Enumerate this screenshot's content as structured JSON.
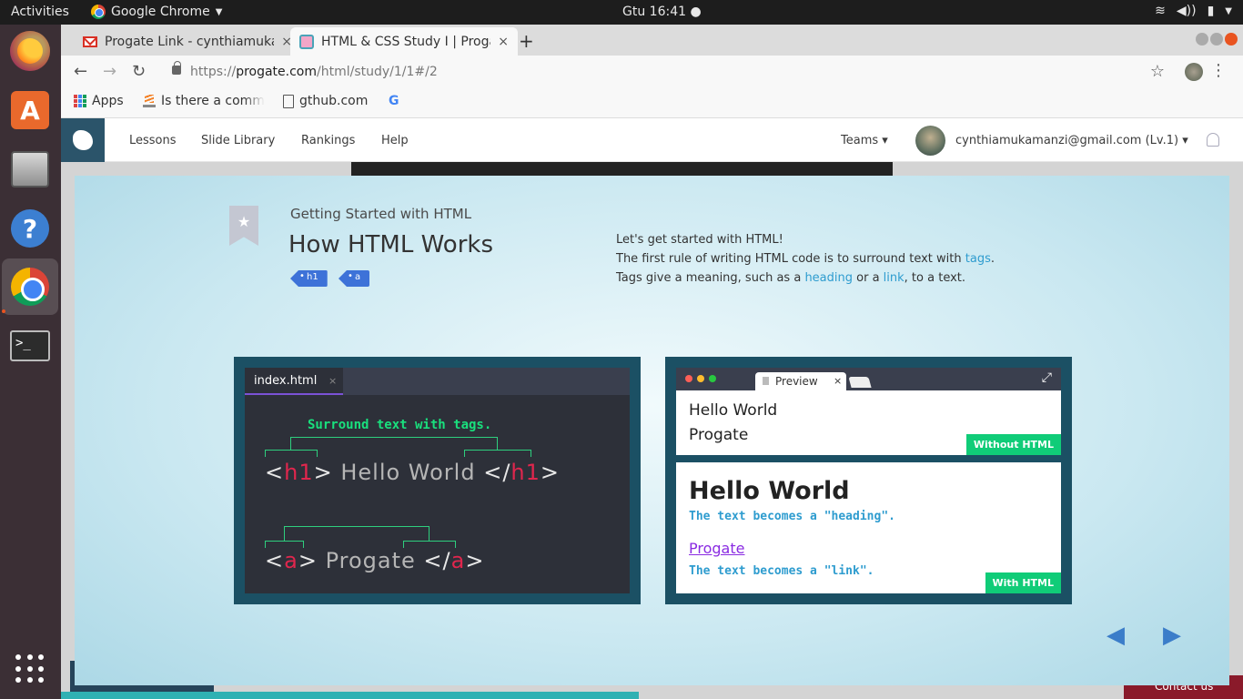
{
  "os": {
    "activities": "Activities",
    "app_name": "Google Chrome",
    "clock": "Gtu 16:41 ●"
  },
  "browser": {
    "tabs": [
      {
        "title": "Progate Link - cynthiamukamanzi",
        "close": "×"
      },
      {
        "title": "HTML & CSS Study I | Progate",
        "close": "×"
      }
    ],
    "new_tab": "+",
    "url_prefix": "https://",
    "url_host": "progate.com",
    "url_path": "/html/study/1/1#/2",
    "bookmarks": [
      "Apps",
      "Is there a command",
      "gthub.com",
      "G"
    ]
  },
  "site": {
    "nav": [
      "Lessons",
      "Slide Library",
      "Rankings",
      "Help"
    ],
    "teams": "Teams ▾",
    "user": "cynthiamukamanzi@gmail.com (Lv.1) ▾",
    "contact": "Contact us"
  },
  "slide": {
    "subtitle": "Getting Started with HTML",
    "title": "How HTML Works",
    "tags": [
      "h1",
      "a"
    ],
    "intro": {
      "line1": "Let's get started with HTML!",
      "line2_pre": "The first rule of writing HTML code is to surround text with ",
      "line2_link": "tags",
      "line2_post": ".",
      "line3_pre": "Tags give a meaning, such as a ",
      "line3_link1": "heading",
      "line3_mid": " or a ",
      "line3_link2": "link",
      "line3_post": ", to a text."
    },
    "editor": {
      "file": "index.html",
      "close": "×",
      "caption": "Surround text with tags.",
      "line1": {
        "lt": "<",
        "tag": "h1",
        "gt": ">",
        "text": " Hello World ",
        "close_lt": "</",
        "close_tag": "h1",
        "close_gt": ">"
      },
      "line2": {
        "lt": "<",
        "tag": "a",
        "gt": ">",
        "text": " Progate ",
        "close_lt": "</",
        "close_tag": "a",
        "close_gt": ">"
      }
    },
    "preview": {
      "tab": "Preview",
      "close": "×",
      "plain_heading": "Hello World",
      "plain_text": "Progate",
      "without_label": "Without HTML",
      "heading": "Hello World",
      "heading_note": "The text becomes a \"heading\".",
      "link": "Progate",
      "link_note": "The text becomes a \"link\".",
      "with_label": "With HTML"
    },
    "prev": "◀",
    "next": "▶"
  }
}
